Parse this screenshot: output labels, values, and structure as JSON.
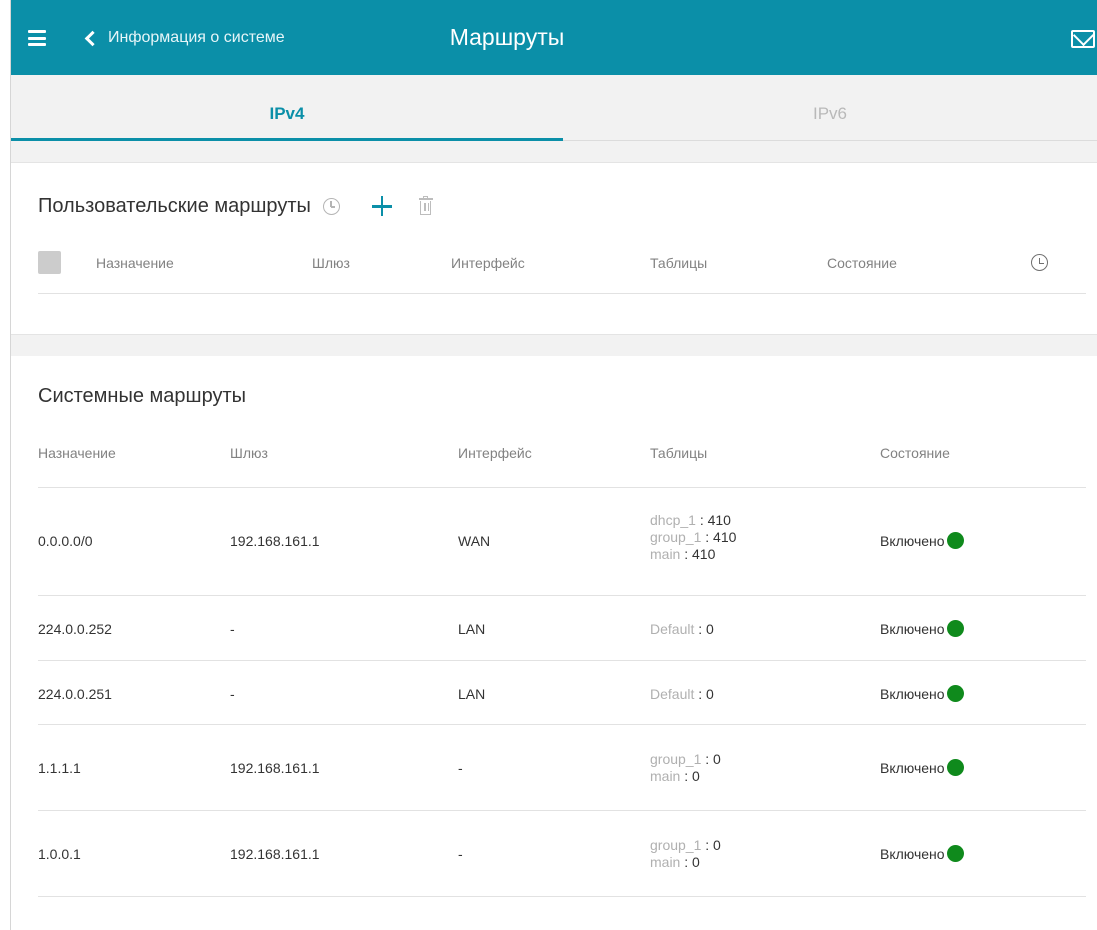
{
  "header": {
    "back_label": "Информация о системе",
    "title": "Маршруты",
    "bg_color": "#0b8fa8",
    "icons": [
      "menu-icon",
      "chevron-left-icon",
      "mail-icon"
    ]
  },
  "tabs": [
    {
      "label": "IPv4",
      "active": true
    },
    {
      "label": "IPv6",
      "active": false
    }
  ],
  "user_routes": {
    "title": "Пользовательские маршруты",
    "icons": [
      "clock-icon",
      "plus-icon",
      "trash-icon"
    ],
    "columns": [
      "Назначение",
      "Шлюз",
      "Интерфейс",
      "Таблицы",
      "Состояние"
    ]
  },
  "system_routes": {
    "title": "Системные маршруты",
    "columns": [
      "Назначение",
      "Шлюз",
      "Интерфейс",
      "Таблицы",
      "Состояние"
    ],
    "rows": [
      {
        "destination": "0.0.0.0/0",
        "gateway": "192.168.161.1",
        "interface": "WAN",
        "tables": [
          {
            "name": "dhcp_1 ",
            "value": ": 410"
          },
          {
            "name": "group_1 ",
            "value": ": 410"
          },
          {
            "name": "main ",
            "value": ": 410"
          }
        ],
        "status": "Включено"
      },
      {
        "destination": "224.0.0.252",
        "gateway": "-",
        "interface": "LAN",
        "tables": [
          {
            "name": "Default ",
            "value": ": 0"
          }
        ],
        "status": "Включено"
      },
      {
        "destination": "224.0.0.251",
        "gateway": "-",
        "interface": "LAN",
        "tables": [
          {
            "name": "Default ",
            "value": ": 0"
          }
        ],
        "status": "Включено"
      },
      {
        "destination": "1.1.1.1",
        "gateway": "192.168.161.1",
        "interface": "-",
        "tables": [
          {
            "name": "group_1 ",
            "value": ": 0"
          },
          {
            "name": "main ",
            "value": ": 0"
          }
        ],
        "status": "Включено"
      },
      {
        "destination": "1.0.0.1",
        "gateway": "192.168.161.1",
        "interface": "-",
        "tables": [
          {
            "name": "group_1 ",
            "value": ": 0"
          },
          {
            "name": "main ",
            "value": ": 0"
          }
        ],
        "status": "Включено"
      }
    ],
    "status_color": "#0f8a1c"
  }
}
